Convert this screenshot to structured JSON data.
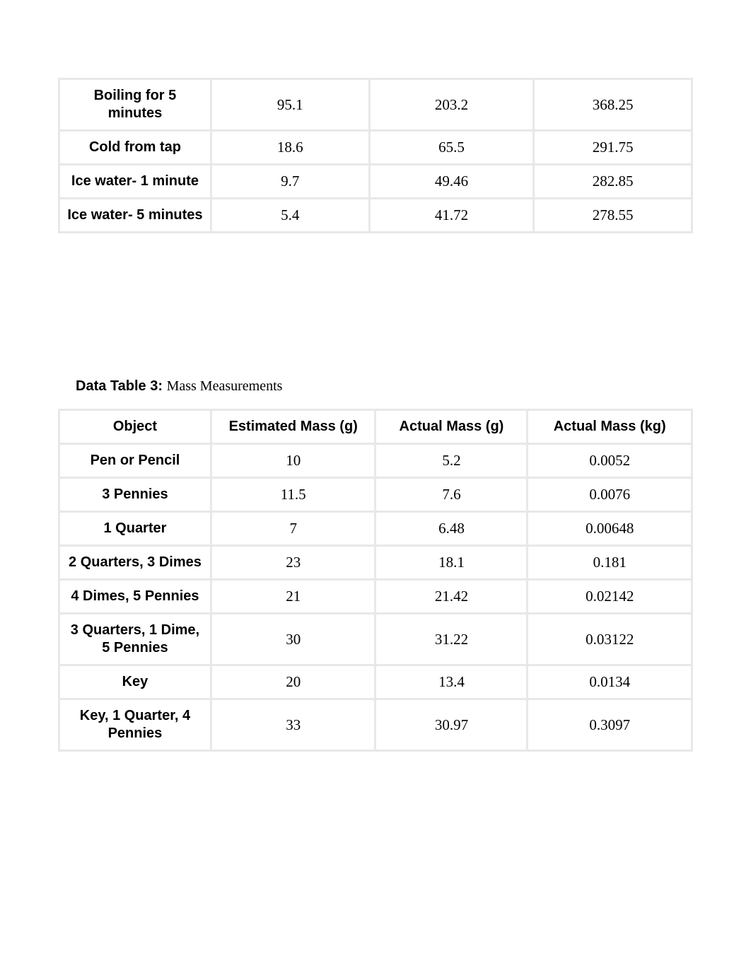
{
  "table1": {
    "rows": [
      {
        "label": "Boiling for 5 minutes",
        "v1": "95.1",
        "v2": "203.2",
        "v3": "368.25"
      },
      {
        "label": "Cold from tap",
        "v1": "18.6",
        "v2": "65.5",
        "v3": "291.75"
      },
      {
        "label": "Ice water- 1 minute",
        "v1": "9.7",
        "v2": "49.46",
        "v3": "282.85"
      },
      {
        "label": "Ice water- 5 minutes",
        "v1": "5.4",
        "v2": "41.72",
        "v3": "278.55"
      }
    ]
  },
  "caption": {
    "bold": "Data Table 3: ",
    "rest": "Mass Measurements"
  },
  "table3": {
    "headers": [
      "Object",
      "Estimated Mass (g)",
      "Actual Mass (g)",
      "Actual Mass (kg)"
    ],
    "rows": [
      {
        "object": "Pen or Pencil",
        "est": "10",
        "actg": "5.2",
        "actkg": "0.0052"
      },
      {
        "object": "3 Pennies",
        "est": "11.5",
        "actg": "7.6",
        "actkg": "0.0076"
      },
      {
        "object": "1 Quarter",
        "est": "7",
        "actg": "6.48",
        "actkg": "0.00648"
      },
      {
        "object": "2 Quarters, 3 Dimes",
        "est": "23",
        "actg": "18.1",
        "actkg": "0.181"
      },
      {
        "object": "4 Dimes, 5 Pennies",
        "est": "21",
        "actg": "21.42",
        "actkg": "0.02142"
      },
      {
        "object": "3 Quarters, 1 Dime, 5 Pennies",
        "est": "30",
        "actg": "31.22",
        "actkg": "0.03122"
      },
      {
        "object": "Key",
        "est": "20",
        "actg": "13.4",
        "actkg": "0.0134"
      },
      {
        "object": "Key, 1 Quarter, 4 Pennies",
        "est": "33",
        "actg": "30.97",
        "actkg": "0.3097"
      }
    ]
  }
}
